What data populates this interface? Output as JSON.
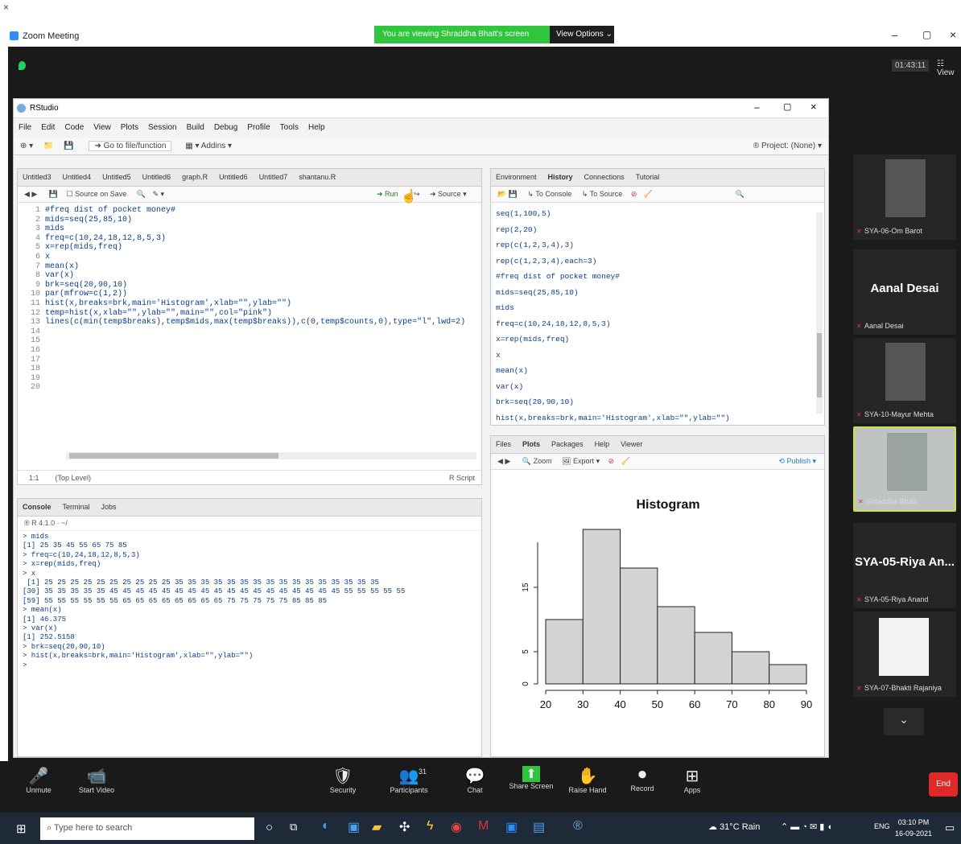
{
  "zoom": {
    "window_title": "Zoom Meeting",
    "banner_text": "You are viewing Shraddha Bhatt's screen",
    "view_options": "View Options",
    "timer": "01:43:11",
    "view_label": "View"
  },
  "rstudio": {
    "app_title": "RStudio",
    "menu": [
      "File",
      "Edit",
      "Code",
      "View",
      "Plots",
      "Session",
      "Build",
      "Debug",
      "Profile",
      "Tools",
      "Help"
    ],
    "toolbar_goto": "Go to file/function",
    "toolbar_addins": "Addins",
    "project": "Project: (None)",
    "editor_tabs": [
      "Untitled3",
      "Untitled4",
      "Untitled5",
      "Untitled6",
      "graph.R",
      "Untitled6",
      "Untitled7",
      "shantanu.R"
    ],
    "editor_toolbar": {
      "source_on_save": "Source on Save",
      "run": "Run",
      "source": "Source"
    },
    "code_lines": [
      "#freq dist of pocket money#",
      "mids=seq(25,85,10)",
      "mids",
      "freq=c(10,24,18,12,8,5,3)",
      "x=rep(mids,freq)",
      "x",
      "mean(x)",
      "var(x)",
      "brk=seq(20,90,10)",
      "par(mfrow=c(1,2))",
      "hist(x,breaks=brk,main='Histogram',xlab=\"\",ylab=\"\")",
      "temp=hist(x,xlab=\"\",ylab=\"\",main=\"\",col=\"pink\")",
      "lines(c(min(temp$breaks),temp$mids,max(temp$breaks)),c(0,temp$counts,0),type=\"l\",lwd=2)",
      "",
      "",
      "",
      "",
      "",
      "",
      ""
    ],
    "editor_status": {
      "pos": "1:1",
      "level": "(Top Level)",
      "lang": "R Script"
    },
    "console_tabs": [
      "Console",
      "Terminal",
      "Jobs"
    ],
    "console_path": "R 4.1.0 · ~/",
    "console_lines": [
      "> mids",
      "[1] 25 35 45 55 65 75 85",
      "> freq=c(10,24,18,12,8,5,3)",
      "> x=rep(mids,freq)",
      "> x",
      " [1] 25 25 25 25 25 25 25 25 25 25 35 35 35 35 35 35 35 35 35 35 35 35 35 35 35 35",
      "[30] 35 35 35 35 35 45 45 45 45 45 45 45 45 45 45 45 45 45 45 45 45 45 45 55 55 55 55 55",
      "[59] 55 55 55 55 55 55 65 65 65 65 65 65 65 65 75 75 75 75 75 85 85 85",
      "> mean(x)",
      "[1] 46.375",
      "> var(x)",
      "[1] 252.5158",
      "> brk=seq(20,90,10)",
      "> hist(x,breaks=brk,main='Histogram',xlab=\"\",ylab=\"\")",
      "> "
    ],
    "env_tabs": [
      "Environment",
      "History",
      "Connections",
      "Tutorial"
    ],
    "env_toolbar": {
      "to_console": "To Console",
      "to_source": "To Source"
    },
    "history_lines": [
      "seq(1,100,5)",
      "rep(2,20)",
      "rep(c(1,2,3,4),3)",
      "rep(c(1,2,3,4),each=3)",
      "#freq dist of pocket money#",
      "mids=seq(25,85,10)",
      "mids",
      "freq=c(10,24,18,12,8,5,3)",
      "x=rep(mids,freq)",
      "x",
      "mean(x)",
      "var(x)",
      "brk=seq(20,90,10)",
      "hist(x,breaks=brk,main='Histogram',xlab=\"\",ylab=\"\")"
    ],
    "files_tabs": [
      "Files",
      "Plots",
      "Packages",
      "Help",
      "Viewer"
    ],
    "plots_toolbar": {
      "zoom": "Zoom",
      "export": "Export",
      "publish": "Publish"
    }
  },
  "chart_data": {
    "type": "bar",
    "title": "Histogram",
    "xlabel": "",
    "ylabel": "",
    "categories": [
      "20-30",
      "30-40",
      "40-50",
      "50-60",
      "60-70",
      "70-80",
      "80-90"
    ],
    "bin_edges": [
      20,
      30,
      40,
      50,
      60,
      70,
      80,
      90
    ],
    "values": [
      10,
      24,
      18,
      12,
      8,
      5,
      3
    ],
    "xticks": [
      "20",
      "30",
      "40",
      "50",
      "60",
      "70",
      "80",
      "90"
    ],
    "yticks": [
      "0",
      "5",
      "15"
    ],
    "ytick_values": [
      0,
      5,
      15
    ],
    "ylim": [
      0,
      24
    ],
    "fill": "#d3d3d3"
  },
  "participants": [
    {
      "name": "SYA-06-Om Barot",
      "kind": "photo"
    },
    {
      "name": "Aanal Desai",
      "big": "Aanal Desai",
      "kind": "text"
    },
    {
      "name": "SYA-10-Mayur Mehta",
      "kind": "photo"
    },
    {
      "name": "Shraddha Bhatt",
      "kind": "active"
    },
    {
      "name": "SYA-05-Riya Anand",
      "big": "SYA-05-Riya An...",
      "kind": "text"
    },
    {
      "name": "SYA-07-Bhakti Rajaniya",
      "kind": "doc"
    }
  ],
  "controls": [
    "Unmute",
    "Start Video",
    "Security",
    "Participants",
    "Chat",
    "Share Screen",
    "Raise Hand",
    "Record",
    "Apps"
  ],
  "participants_count": "31",
  "end_label": "End",
  "taskbar": {
    "search": "Type here to search",
    "weather": "31°C Rain",
    "lang": "ENG",
    "time": "03:10 PM",
    "date": "16-09-2021"
  },
  "colors": {
    "zoom_dark": "#1a1a1a",
    "share_green": "#2fc53c",
    "end_red": "#e02828",
    "active_border": "#c8e04a"
  }
}
